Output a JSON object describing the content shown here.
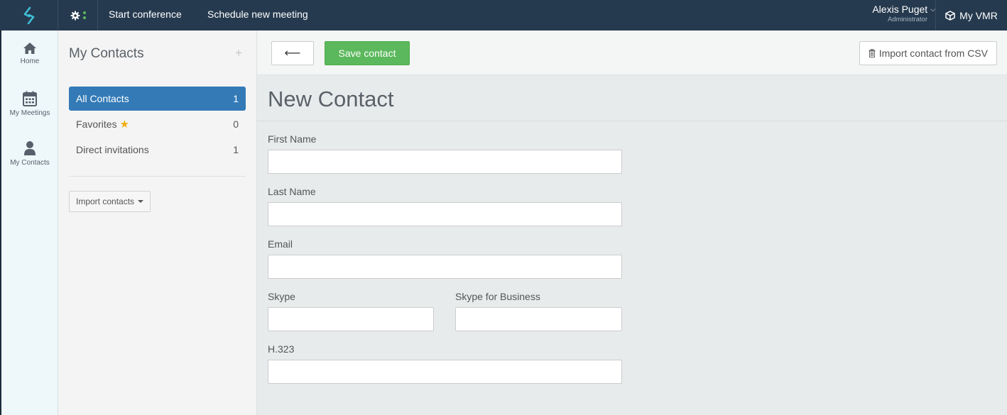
{
  "topbar": {
    "start_conference": "Start conference",
    "schedule_meeting": "Schedule new meeting",
    "user_name": "Alexis Puget",
    "user_role": "Administrator",
    "my_vmr": "My VMR"
  },
  "leftnav": {
    "items": [
      {
        "label": "Home",
        "icon": "home-icon"
      },
      {
        "label": "My Meetings",
        "icon": "calendar-icon"
      },
      {
        "label": "My Contacts",
        "icon": "user-icon"
      }
    ]
  },
  "sidebar": {
    "title": "My Contacts",
    "add_symbol": "+",
    "items": [
      {
        "label": "All Contacts",
        "count": "1",
        "active": true
      },
      {
        "label": "Favorites",
        "count": "0",
        "active": false
      },
      {
        "label": "Direct invitations",
        "count": "1",
        "active": false
      }
    ],
    "import_label": "Import contacts"
  },
  "toolbar": {
    "back_symbol": "⟵",
    "save_label": "Save contact",
    "import_csv_label": "Import contact from CSV"
  },
  "form": {
    "title": "New Contact",
    "first_name_label": "First Name",
    "first_name_value": "",
    "last_name_label": "Last Name",
    "last_name_value": "",
    "email_label": "Email",
    "email_value": "",
    "skype_label": "Skype",
    "skype_value": "",
    "skype_business_label": "Skype for Business",
    "skype_business_value": "",
    "h323_label": "H.323",
    "h323_value": ""
  },
  "colors": {
    "topbar": "#263a4f",
    "active": "#337ab7",
    "save": "#5cb85c",
    "accent_logo": "#3fc0d8",
    "star": "#f0ad0e"
  }
}
